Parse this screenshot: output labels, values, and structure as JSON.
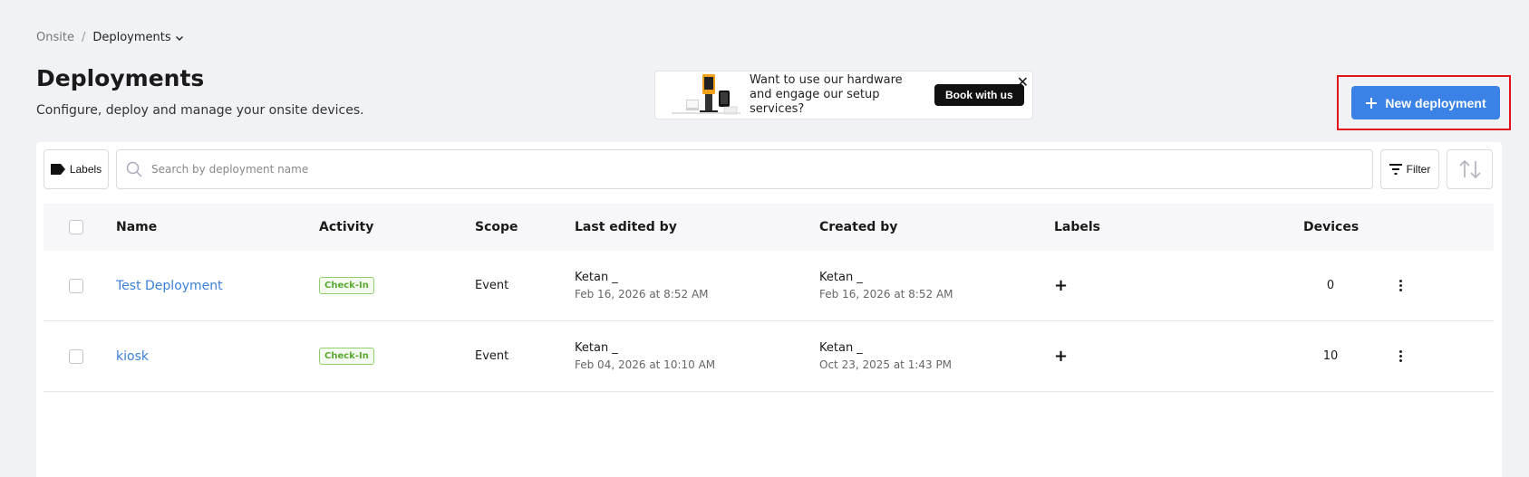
{
  "breadcrumb": {
    "root": "Onsite",
    "separator": "/",
    "current": "Deployments"
  },
  "page": {
    "title": "Deployments",
    "subtitle": "Configure, deploy and manage your onsite devices."
  },
  "promo": {
    "text": "Want to use our hardware and engage our setup services?",
    "button": "Book with us",
    "close": "✕"
  },
  "actions": {
    "new_deployment": "New deployment"
  },
  "toolbar": {
    "labels": "Labels",
    "search_placeholder": "Search by deployment name",
    "filter": "Filter"
  },
  "table": {
    "headers": {
      "name": "Name",
      "activity": "Activity",
      "scope": "Scope",
      "last_edited": "Last edited by",
      "created": "Created by",
      "labels": "Labels",
      "devices": "Devices"
    },
    "rows": [
      {
        "name": "Test Deployment",
        "activity": "Check-In",
        "scope": "Event",
        "edited_by": "Ketan _",
        "edited_date": "Feb 16, 2026 at 8:52 AM",
        "created_by": "Ketan _",
        "created_date": "Feb 16, 2026 at 8:52 AM",
        "labels_add": "+",
        "devices": "0"
      },
      {
        "name": "kiosk",
        "activity": "Check-In",
        "scope": "Event",
        "edited_by": "Ketan _",
        "edited_date": "Feb 04, 2026 at 10:10 AM",
        "created_by": "Ketan _",
        "created_date": "Oct 23, 2025 at 1:43 PM",
        "labels_add": "+",
        "devices": "10"
      }
    ]
  },
  "colors": {
    "primary": "#3b82e6",
    "link": "#3b7fd9",
    "badge_green": "#5aa832",
    "highlight_red": "#e4121b",
    "background": "#f1f2f5"
  }
}
